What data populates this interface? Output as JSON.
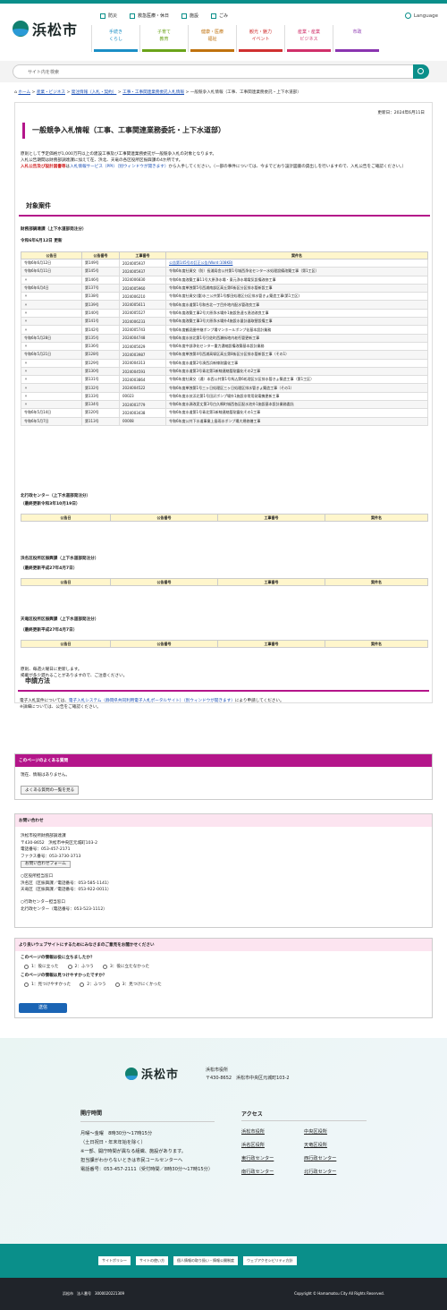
{
  "header": {
    "logo_text": "浜松市",
    "utility": [
      "防災",
      "救急医療・休日",
      "施設",
      "ごみ"
    ],
    "lang": "Language",
    "nav": [
      "手続き\nくらし",
      "子育て\n教育",
      "健康・医療\n福祉",
      "観光・魅力\nイベント",
      "産業・産業\nビジネス",
      "市政"
    ]
  },
  "search": {
    "placeholder": "サイト内を検索"
  },
  "crumb": [
    "ホーム",
    "産業・ビジネス",
    "発注情報（入札・契約）",
    "工事・工事関連業務委託入札情報",
    "一般競争入札情報（工事、工事関連業務委託・上下水道部）"
  ],
  "page": {
    "updated": "更新日：2024年6月11日",
    "title": "一般競争入札情報（工事、工事関連業務委託・上下水道部）",
    "intro1": "原則として予定価格が1,000万円以上の建設工事及び工事関連業務委託が一般競争入札の対象となります。",
    "intro2": "入札公告期間は財務部調達課に加えて在、浜北、天竜の各区役所区振興課の4か所です。",
    "intro3_red": "入札公告及び設計図書等",
    "intro3": "は",
    "intro3_link": "入札情報サービス（PPI）（別ウィンドウが開きます）",
    "intro3_tail": "から入手してください。（一部の事件については、今までどおり設計図書の貸出しを行いますので、入札公告をご確認ください。）",
    "sec1": "対象案件",
    "sec2": "申請方法",
    "sub1": "財務部調達課（上下水道部発注分）",
    "sub1b": "令和6年6月12日 更新",
    "sub2": "北行政センター（上下水道部発注分）",
    "sub2b": "（最終更新令和3年10月19日）",
    "sub3": "浜名区役所区振興課（上下水道部発注分）",
    "sub3b": "（最終更新平成27年4月7日）",
    "sub4": "天竜区役所区振興課（上下水道部発注分）",
    "sub4b": "（最終更新平成27年4月7日）",
    "note1": "原則、毎週火曜日に更新します。",
    "note2": "掲載が多少遅れることがありますので、ご注意ください。",
    "apply1": "電子入札案件については、",
    "apply_link": "電子入札システム（静岡県共同利用電子入札ポータルサイト）（別ウィンドウが開きます）",
    "apply2": "により申請してください。",
    "apply3": "※詳細については、公告をご確認ください。"
  },
  "table": {
    "headers": [
      "公告日",
      "公告番号",
      "工事番号",
      "案件名"
    ],
    "empty_headers": [
      "公告日",
      "公告番号",
      "工事番号",
      "案件名"
    ],
    "rows": [
      [
        "令和6年6月12日",
        "第149号",
        "2024005937",
        "公告第145号の訂正公告(Word:108KB)"
      ],
      [
        "令和6年6月11日",
        "第145号",
        "2024005937",
        "令和6年度社資交（防）長浦局舎公共第1号城西浄化センター水処理設備改築工事（第1工区）"
      ],
      [
        "〃",
        "第146号",
        "2024006830",
        "令和6年度改築工事11号大原浄水場・東元浄水場電気設備改修工事"
      ],
      [
        "令和6年6月4日",
        "第137号",
        "2024005960",
        "令和6年度単独第5号西浦南部区高丘第6街区分区排水管新設工事"
      ],
      [
        "〃",
        "第138号",
        "2024006210",
        "令和6年度社資交(重)水三公共第1号都田処理区分区排水管きょ築造工事(第1工区)"
      ],
      [
        "〃",
        "第139号",
        "2024005611",
        "令和6年度水道第1号和合北一丁目外地内配水管改良工事"
      ],
      [
        "〃",
        "第140号",
        "2024005527",
        "令和6年度改築工事2号大原浄水場外1施設急速ろ過池改良工事"
      ],
      [
        "〃",
        "第141号",
        "2024006233",
        "令和6年度改築工事3号大原浄水場外4施設水量計器取替設備工事"
      ],
      [
        "〃",
        "第142号",
        "2024005743",
        "令和6年度鶴見圏中継ポンプ場マンホールポンプ化基本設計業務"
      ],
      [
        "令和6年5月28日",
        "第135号",
        "2024004748",
        "令和6年度水技北第1号引佐町西瀬街地内老朽管更新工事"
      ],
      [
        "〃",
        "第136号",
        "2024005029",
        "令和6年度中部浄化センター重力濃縮設備改築基本設計業務"
      ],
      [
        "令和6年5月21日",
        "第128号",
        "2024003987",
        "令和6年度単独第4号西浦高塚区高丘第8街区分区排水管新設工事（その1）"
      ],
      [
        "〃",
        "第129号",
        "2024004313",
        "令和6年度水道第2号湊西浜新線耐震化工事"
      ],
      [
        "〃",
        "第130号",
        "2024004593",
        "令和6年度水道第3号青北第1新線連絡管耐震化その2工事"
      ],
      [
        "〃",
        "第131号",
        "2024003864",
        "令和6年度社資交（通）本西公共第1号馬込第6処理区分区排水管きょ築造工事（第1工区）"
      ],
      [
        "〃",
        "第132号",
        "2024004522",
        "令和6年度単独第1号三ヶ日処理区三ヶ日処理区排水管きょ築造工事（その1）"
      ],
      [
        "〃",
        "第133号",
        "00023",
        "令和6年度水技浜北第1号田沢ポンプ場外1施設非常用発電機更新工事"
      ],
      [
        "〃",
        "第134号",
        "2024003779",
        "令和6年度水源改変丈第3号白久桐町城西各区配水池外1施設基本設計業務委託"
      ],
      [
        "令和6年5月14日",
        "第120号",
        "2024003438",
        "令和6年度水道第1号青北第1新線連絡管耐震化その1工事"
      ],
      [
        "令和6年5月7日",
        "第113号",
        "00008",
        "令和6年度公共下水道事業上島雨水ポンプ場大規修繕工事"
      ]
    ]
  },
  "faq": {
    "header": "このページのよくある質問",
    "text": "現在、情報はありません。",
    "button": "よくある質問の一覧を見る"
  },
  "contact": {
    "header": "お問い合わせ",
    "lines": [
      "浜松市役所財務部調達課",
      "〒430-8652　浜松市中央区元城町103-2",
      "電話番号：053-457-2171",
      "ファクス番号：053-3730-3713"
    ],
    "form_button": "お問い合わせフォーム",
    "lines2": [
      "○区役所担当窓口",
      "浜名区（区振興課／電話番号：053-585-1141）",
      "天竜区（区振興課／電話番号：053-922-0011）",
      "",
      "○行政センター担当窓口",
      "北行政センター（電話番号：053-523-1112）"
    ]
  },
  "survey": {
    "header": "より良いウェブサイトにするためにみなさまのご意見をお聞かせください",
    "q1": "このページの情報は役に立ちましたか？",
    "a1": [
      "1：役に立った",
      "2：ふつう",
      "3：役に立たなかった"
    ],
    "q2": "このページの情報は見つけやすかったですか？",
    "a2": [
      "1：見つけやすかった",
      "2：ふつう",
      "3：見つけにくかった"
    ],
    "send": "送信"
  },
  "footer": {
    "logo_text": "浜松市",
    "office": "浜松市役所",
    "address": "〒430-8652　浜松市中央区元城町103-2",
    "open_head": "開庁時間",
    "open": [
      "月曜～金曜　8時30分～17時15分",
      "（土日祝日・年末年始を除く）",
      "※一部、開庁時間が異なる組織、施設があります。",
      "担当課がわからないときは市民コールセンターへ",
      "電話番号：053-457-2111（受付時間／8時30分～17時15分）"
    ],
    "access_head": "アクセス",
    "access": [
      "浜松市役所",
      "中央区役所",
      "浜名区役所",
      "天竜区役所",
      "東行政センター",
      "西行政センター",
      "南行政センター",
      "北行政センター"
    ],
    "links": [
      "サイトポリシー",
      "サイトの使い方",
      "個人情報の取り扱い・情報公開制度",
      "ウェブアクセシビリティ方針"
    ],
    "bottom_left": "浜松市　法人番号　3000020221309",
    "copyright": "Copyright © Hamamatsu City All Rights Reserved."
  }
}
